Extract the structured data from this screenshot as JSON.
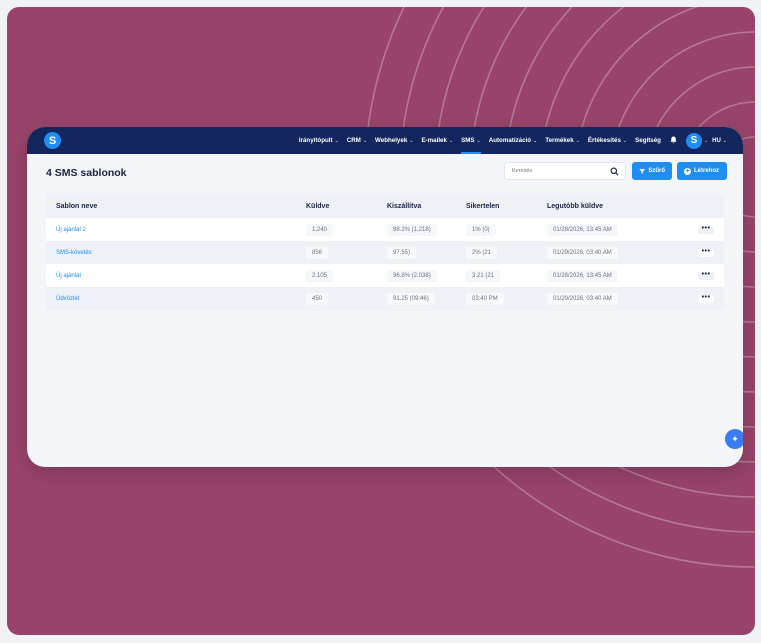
{
  "brand": {
    "logo_letter": "S"
  },
  "nav": {
    "items": [
      {
        "label": "Irányítópult"
      },
      {
        "label": "CRM"
      },
      {
        "label": "Webhelyek"
      },
      {
        "label": "E-mailek"
      },
      {
        "label": "SMS",
        "active": true
      },
      {
        "label": "Automatizáció"
      },
      {
        "label": "Termékek"
      },
      {
        "label": "Értékesítés"
      }
    ],
    "help_label": "Segítség",
    "avatar_letter": "S",
    "language": "HU"
  },
  "page": {
    "title": "4 SMS sablonok"
  },
  "search": {
    "placeholder": "Keresés"
  },
  "toolbar": {
    "filter_label": "Szűrő",
    "create_label": "Létrehoz"
  },
  "table": {
    "headers": {
      "name": "Sablon neve",
      "sent": "Küldve",
      "delivered": "Kiszállítva",
      "failed": "Sikertelen",
      "last_sent": "Legutóbb küldve"
    },
    "rows": [
      {
        "name": "Új ajánlat 2",
        "sent": "1,240",
        "delivered": "98.2% (1,218)",
        "failed": "1% (0)",
        "last_sent": "01/28/2026, 13:45 AM"
      },
      {
        "name": "SMS-követés",
        "sent": "856",
        "delivered": "97.55)",
        "failed": "2% (21",
        "last_sent": "01/29/2026, 03:40 AM"
      },
      {
        "name": "Új ajánlat",
        "sent": "2.105",
        "delivered": "96.8% (2.038)",
        "failed": "3.21 (21",
        "last_sent": "01/28/2026, 13:45 AM"
      },
      {
        "name": "Üdvözlet",
        "sent": "450",
        "delivered": "91.25 (09:46)",
        "failed": "03:40 PM",
        "last_sent": "01/29/2026, 03:40 AM"
      }
    ],
    "row_action_glyph": "•••"
  },
  "colors": {
    "background_magenta": "#98446a",
    "nav_navy": "#14265e",
    "accent_blue": "#1e8ef5"
  },
  "icons": {
    "search": "search-icon",
    "filter": "filter-icon",
    "create": "plus-circle-icon",
    "bell": "bell-icon",
    "chevron": "chevron-down-icon",
    "assistant": "sparkle-icon"
  }
}
